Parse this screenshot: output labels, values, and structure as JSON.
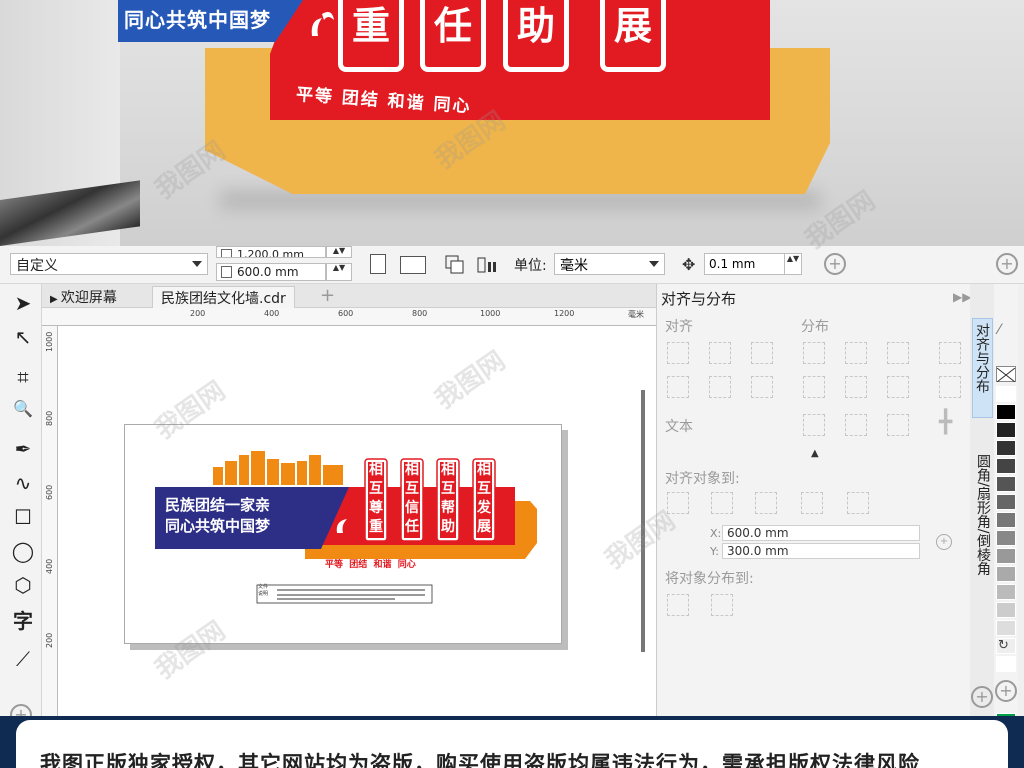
{
  "render": {
    "blue_text": "同心共筑中国梦",
    "tiles": [
      "重",
      "任",
      "助",
      "展"
    ],
    "hands_glyph": "ꜱ",
    "slogan": "平等 团结 和谐 同心"
  },
  "toolbar": {
    "preset": "自定义",
    "width": "1,200.0 mm",
    "height": "600.0 mm",
    "units_label": "单位:",
    "units": "毫米",
    "nudge": "0.1 mm"
  },
  "toolbox_icons": [
    "pick-tool-icon",
    "shape-tool-icon",
    "crop-tool-icon",
    "zoom-tool-icon",
    "pen-tool-icon",
    "curve-tool-icon",
    "rectangle-tool-icon",
    "ellipse-tool-icon",
    "polygon-tool-icon",
    "text-tool-icon",
    "connector-tool-icon"
  ],
  "toolbox_glyphs": [
    "➤",
    "↖",
    "⌗",
    "🔍",
    "✒",
    "∿",
    "☐",
    "◯",
    "⬡",
    "字",
    "⟋"
  ],
  "tabs": {
    "welcome": "欢迎屏幕",
    "doc": "民族团结文化墙.cdr"
  },
  "ruler": {
    "unit": "毫米",
    "h_ticks": [
      "200",
      "400",
      "600",
      "800",
      "1000",
      "1200"
    ],
    "v_ticks": [
      "1000",
      "800",
      "600",
      "400",
      "200"
    ]
  },
  "design": {
    "banner_line1": "民族团结一家亲",
    "banner_line2": "同心共筑中国梦",
    "columns": [
      [
        "相",
        "互",
        "尊",
        "重"
      ],
      [
        "相",
        "互",
        "信",
        "任"
      ],
      [
        "相",
        "互",
        "帮",
        "助"
      ],
      [
        "相",
        "互",
        "发",
        "展"
      ]
    ],
    "slogan": "平等  团结  和谐  同心",
    "nameplate": "文件\n说明"
  },
  "docker": {
    "title": "对齐与分布",
    "align": "对齐",
    "distribute": "分布",
    "text": "文本",
    "align_to": "对齐对象到:",
    "x_label": "X:",
    "x_value": "600.0 mm",
    "y_label": "Y:",
    "y_value": "300.0 mm",
    "distribute_to": "将对象分布到:"
  },
  "side_tabs": {
    "align": "对齐与分布",
    "fillet": "圆角/扇形角/倒棱角"
  },
  "palette": [
    "#ffffff",
    "#000000",
    "#222222",
    "#333333",
    "#444444",
    "#555555",
    "#666666",
    "#777777",
    "#888888",
    "#999999",
    "#aaaaaa",
    "#bbbbbb",
    "#cccccc",
    "#dddddd",
    "#eeeeee",
    "#ffffff",
    "#00a04b",
    "#1a73e8",
    "#ffe600",
    "#e61e1e",
    "#e4007f"
  ],
  "colors": {
    "red": "#e21b22",
    "blue": "#2d2e86",
    "orange": "#f08a12",
    "gold": "#f0b54a"
  },
  "watermark": "我图网",
  "footer": "我图正版独家授权，其它网站均为盗版，购买使用盗版均属违法行为，需承担版权法律风险"
}
